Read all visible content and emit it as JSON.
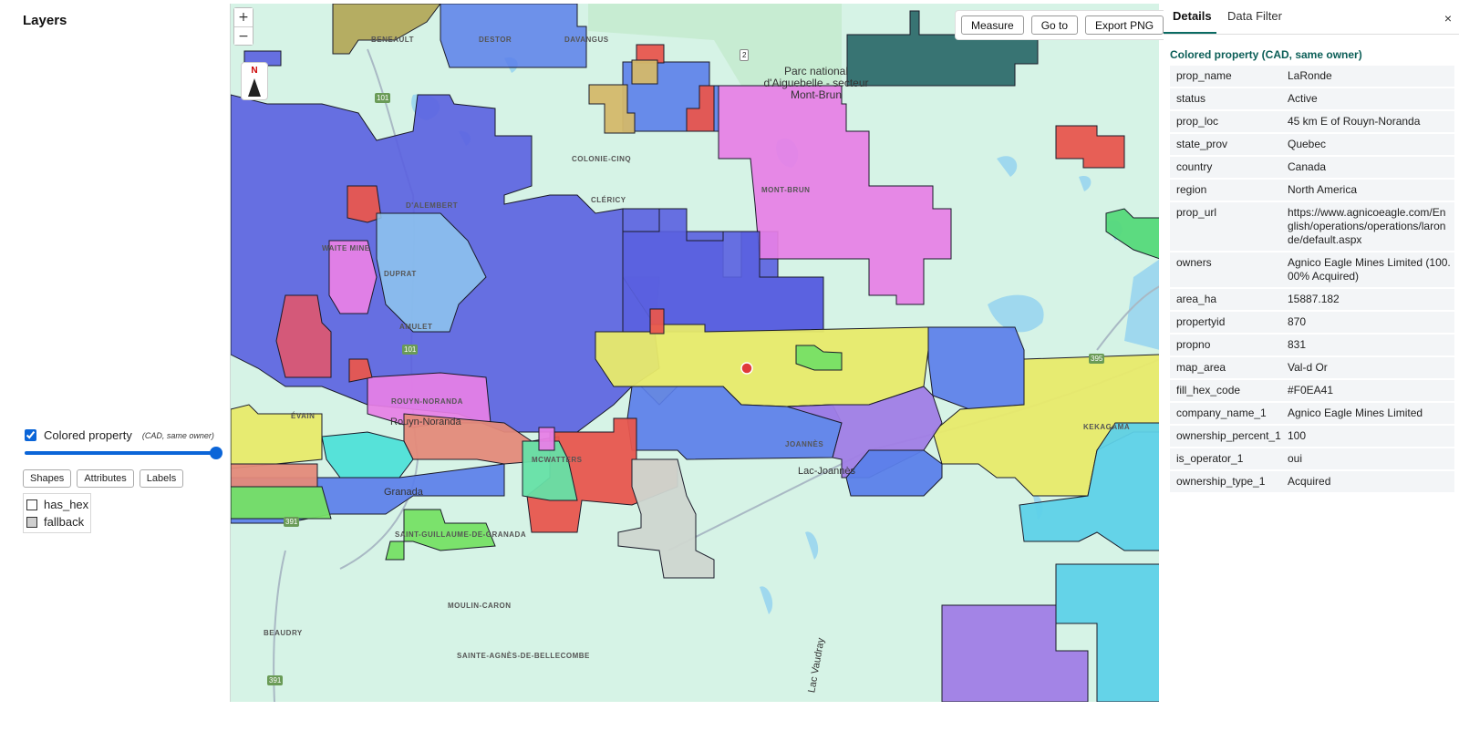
{
  "layers_panel": {
    "title": "Layers",
    "layer": {
      "name": "Colored property",
      "note": "(CAD, same owner)",
      "checked": true,
      "opacity": 1.0
    },
    "buttons": [
      "Shapes",
      "Attributes",
      "Labels"
    ],
    "legend": [
      {
        "label": "has_hex",
        "swatch": "#ffffff"
      },
      {
        "label": "fallback",
        "swatch": "#cfcfcf"
      }
    ]
  },
  "map": {
    "zoom_in": "+",
    "zoom_out": "−",
    "north_label": "N",
    "toolbar": [
      "Measure",
      "Go to",
      "Export PNG"
    ],
    "marker_color": "#e03a3a",
    "places": [
      "DESTOR",
      "DAVANGUS",
      "COLONIE-CINQ",
      "CLÉRICY",
      "MONT-BRUN",
      "D'ALEMBERT",
      "WAITE MINE",
      "DUPRAT",
      "AMULET",
      "ÉVAIN",
      "MCWATTERS",
      "JOANNÈS",
      "KEKAGAMA",
      "MOULIN-CARON",
      "BEAUDRY",
      "SAINTE-AGNÈS-DE-BELLECOMBE",
      "SAINT-GUILLAUME-DE-GRANADA",
      "BENEAULT",
      "ROUYN-NORANDA"
    ],
    "towns": [
      "Rouyn-Noranda",
      "Lac-Joannès",
      "Granada",
      "Lac Vaudray"
    ],
    "park": "Parc national d'Aiguebelle - secteur Mont-Brun",
    "shields": [
      "101",
      "101",
      "2",
      "391",
      "391",
      "395"
    ]
  },
  "details": {
    "tabs": [
      "Details",
      "Data Filter"
    ],
    "close": "×",
    "title": "Colored property (CAD, same owner)",
    "rows": [
      {
        "k": "prop_name",
        "v": "LaRonde"
      },
      {
        "k": "status",
        "v": "Active"
      },
      {
        "k": "prop_loc",
        "v": "45 km E of Rouyn-Noranda"
      },
      {
        "k": "state_prov",
        "v": "Quebec"
      },
      {
        "k": "country",
        "v": "Canada"
      },
      {
        "k": "region",
        "v": "North America"
      },
      {
        "k": "prop_url",
        "v": "https://www.agnicoeagle.com/English/operations/operations/laronde/default.aspx"
      },
      {
        "k": "owners",
        "v": "Agnico Eagle Mines Limited (100.00% Acquired)"
      },
      {
        "k": "area_ha",
        "v": "15887.182"
      },
      {
        "k": "propertyid",
        "v": "870"
      },
      {
        "k": "propno",
        "v": "831"
      },
      {
        "k": "map_area",
        "v": "Val-d Or"
      },
      {
        "k": "fill_hex_code",
        "v": "#F0EA41"
      },
      {
        "k": "company_name_1",
        "v": "Agnico Eagle Mines Limited"
      },
      {
        "k": "ownership_percent_1",
        "v": "100"
      },
      {
        "k": "is_operator_1",
        "v": "oui"
      },
      {
        "k": "ownership_type_1",
        "v": "Acquired"
      }
    ]
  },
  "colors": {
    "accent": "#0b65d8",
    "panel_title": "#0b5e57",
    "map_bg": "#d6f3e6",
    "water": "#9fd8ee",
    "blue_prop": "#5a60e0",
    "yellow_prop": "#e8ea6a",
    "pink_prop": "#e77fe6",
    "red_prop": "#e8564e",
    "cyan_prop": "#5ed1e8",
    "purple_prop": "#a07de6",
    "teal_prop": "#2f6d6d",
    "green_prop": "#76e065",
    "gray_prop": "#cfd6d0"
  }
}
